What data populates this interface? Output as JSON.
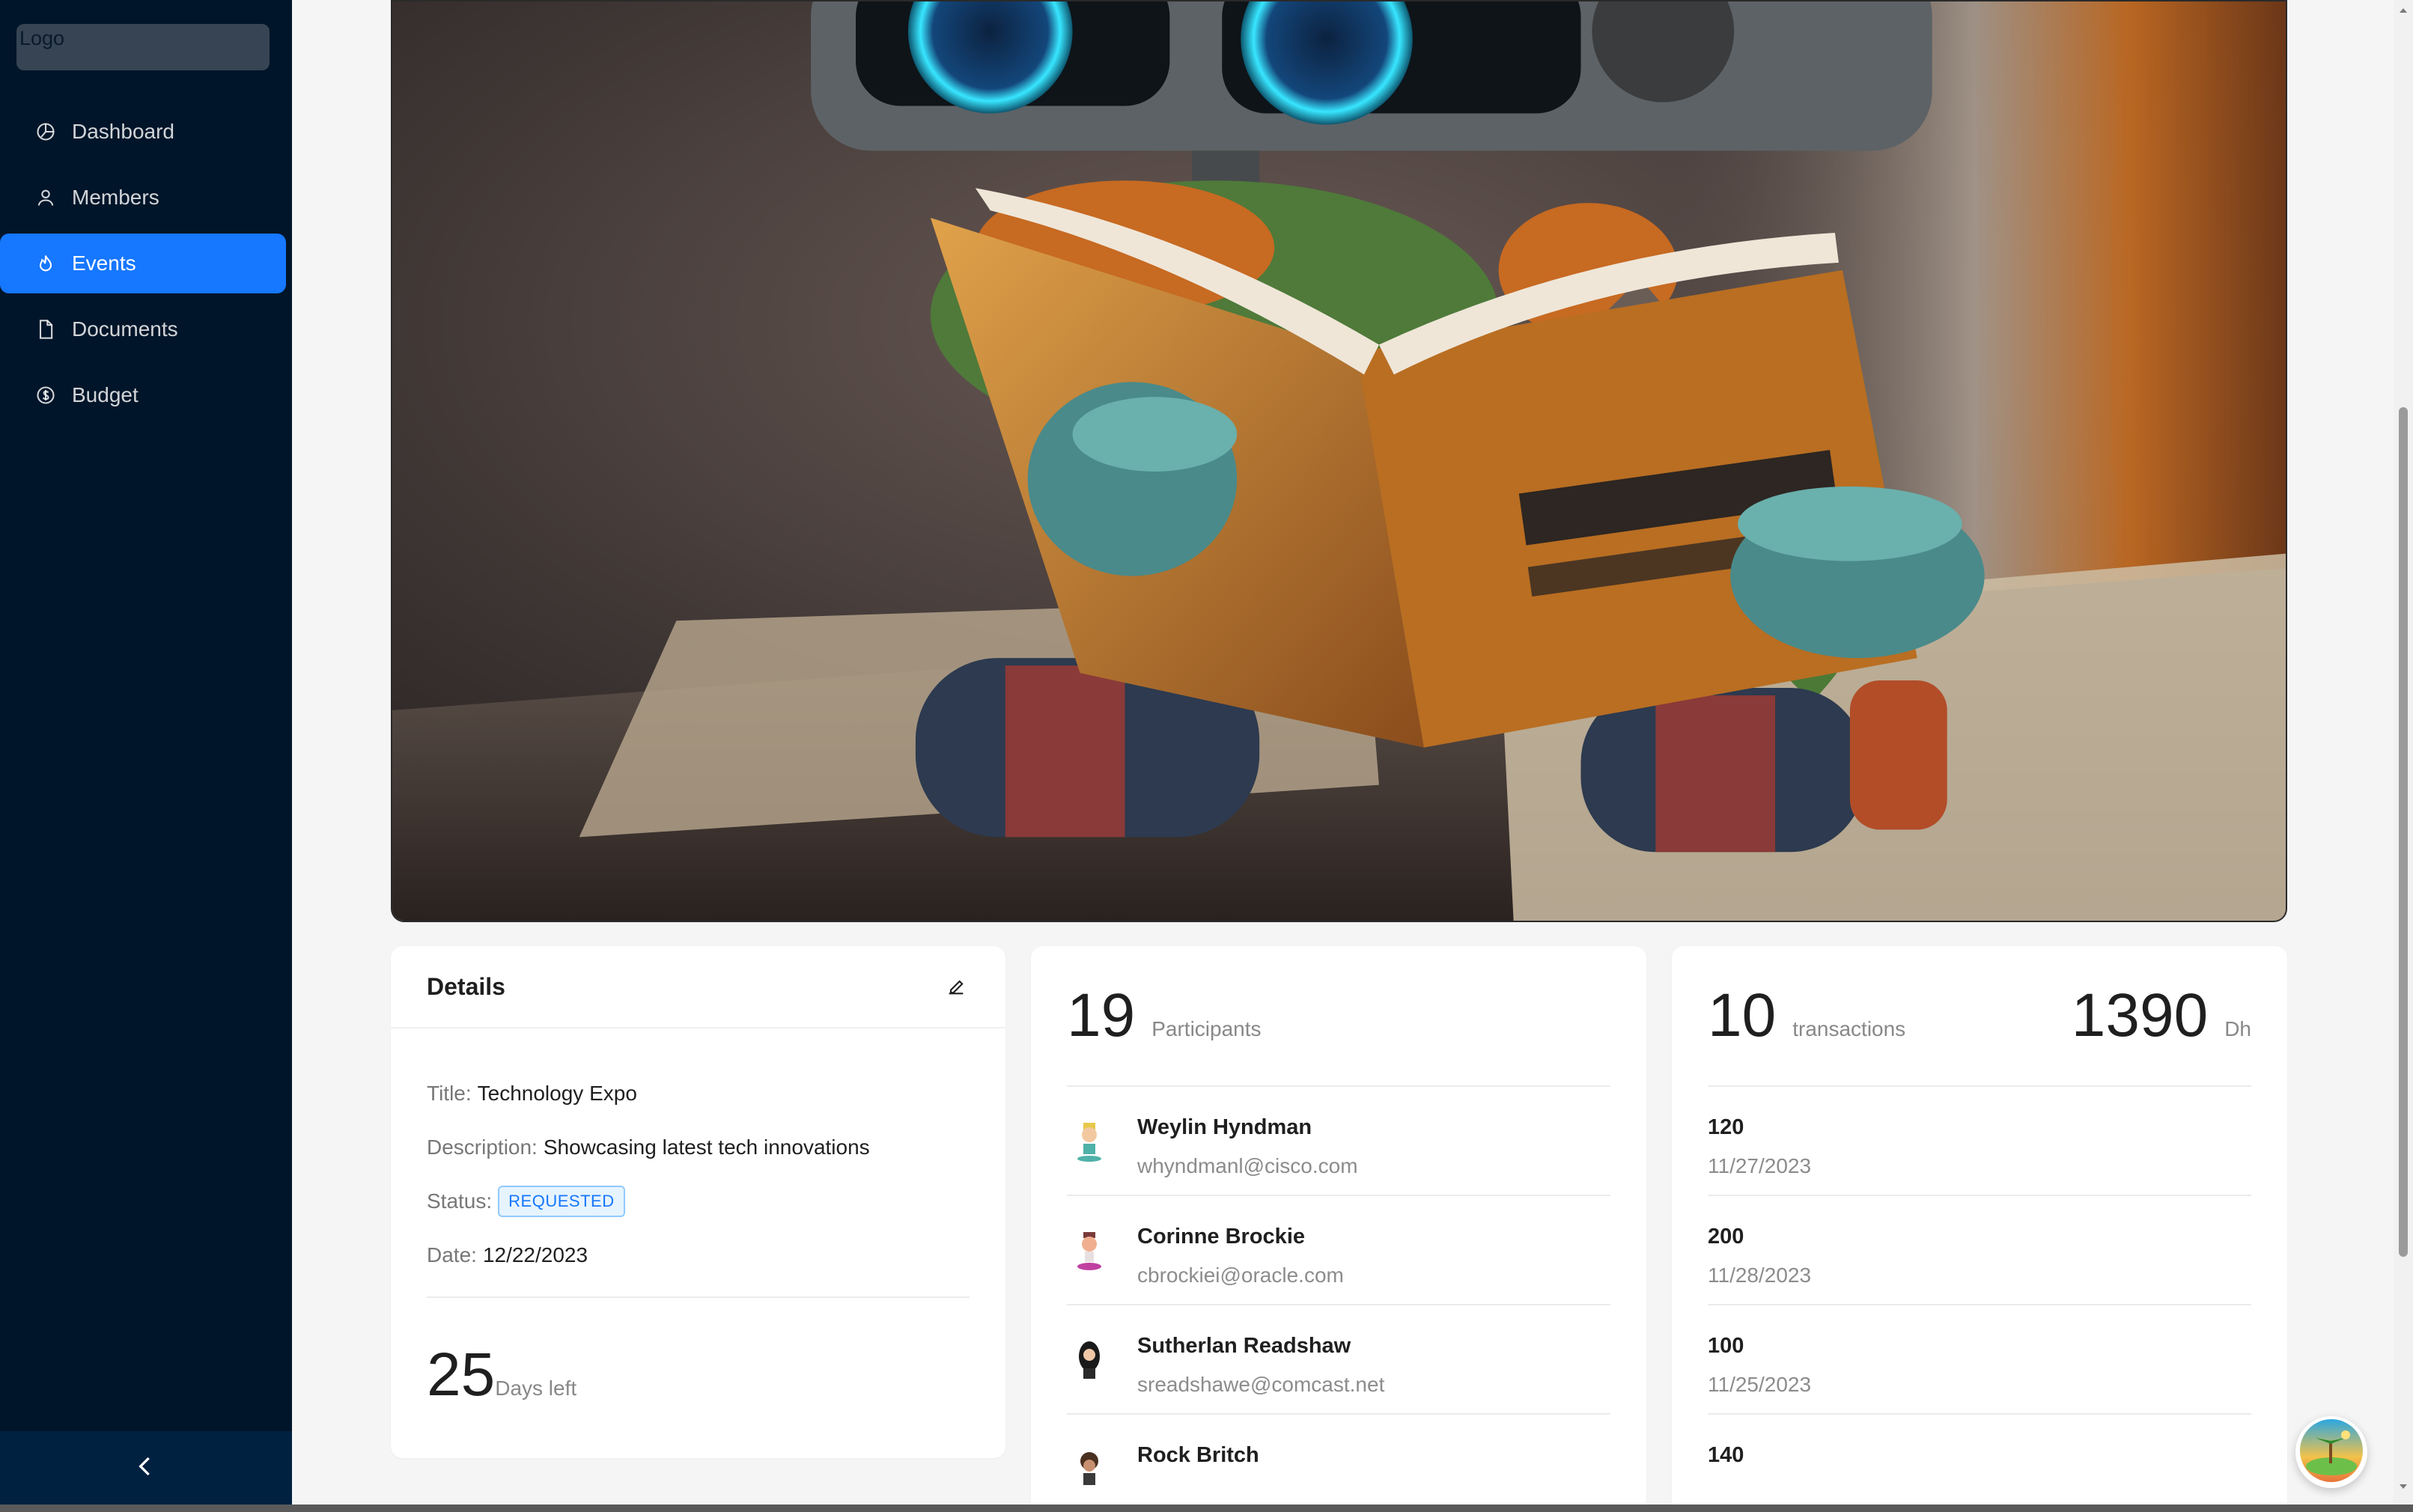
{
  "sidebar": {
    "logo": "Logo",
    "items": [
      {
        "label": "Dashboard",
        "icon": "pie-chart-icon",
        "active": false
      },
      {
        "label": "Members",
        "icon": "user-icon",
        "active": false
      },
      {
        "label": "Events",
        "icon": "fire-icon",
        "active": true
      },
      {
        "label": "Documents",
        "icon": "file-icon",
        "active": false
      },
      {
        "label": "Budget",
        "icon": "dollar-icon",
        "active": false
      }
    ],
    "collapse_icon": "chevron-left-icon"
  },
  "hero": {
    "image": "robot-reading-book"
  },
  "details": {
    "heading": "Details",
    "title_label": "Title:",
    "title_value": "Technology Expo",
    "description_label": "Description:",
    "description_value": "Showcasing latest tech innovations",
    "status_label": "Status:",
    "status_value": "REQUESTED",
    "date_label": "Date:",
    "date_value": "12/22/2023",
    "days_left_value": "25",
    "days_left_label": "Days left"
  },
  "participants": {
    "count": "19",
    "count_label": "Participants",
    "items": [
      {
        "name": "Weylin Hyndman",
        "email": "whyndmanl@cisco.com"
      },
      {
        "name": "Corinne Brockie",
        "email": "cbrockiei@oracle.com"
      },
      {
        "name": "Sutherlan Readshaw",
        "email": "sreadshawe@comcast.net"
      },
      {
        "name": "Rock Britch",
        "email": ""
      }
    ]
  },
  "transactions": {
    "count": "10",
    "count_label": "transactions",
    "total": "1390",
    "currency": "Dh",
    "items": [
      {
        "amount": "120",
        "date": "11/27/2023"
      },
      {
        "amount": "200",
        "date": "11/28/2023"
      },
      {
        "amount": "100",
        "date": "11/25/2023"
      },
      {
        "amount": "140",
        "date": ""
      }
    ]
  },
  "colors": {
    "sidebar_bg": "#001529",
    "accent": "#1677ff",
    "page_bg": "#f5f5f5"
  }
}
